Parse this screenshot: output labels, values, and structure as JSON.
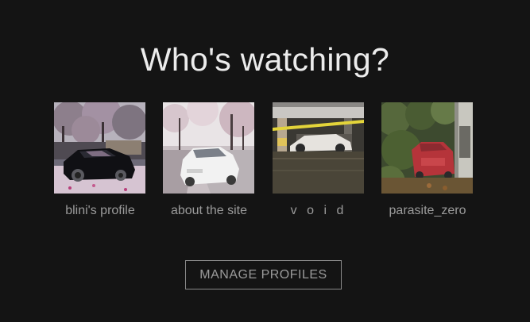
{
  "header": {
    "title": "Who's watching?"
  },
  "profiles": [
    {
      "name": "blini's profile",
      "image": "black-car-under-cherry-blossoms"
    },
    {
      "name": "about the site",
      "image": "white-car-on-blossom-road"
    },
    {
      "name": "v o i d",
      "image": "white-car-in-flooded-garage"
    },
    {
      "name": "parasite_zero",
      "image": "red-car-overgrown-in-foliage"
    }
  ],
  "actions": {
    "manage_label": "MANAGE PROFILES"
  },
  "colors": {
    "background": "#141414",
    "title": "#ececec",
    "muted_text": "#9b9b9b",
    "button_border": "#8a8a8a"
  }
}
